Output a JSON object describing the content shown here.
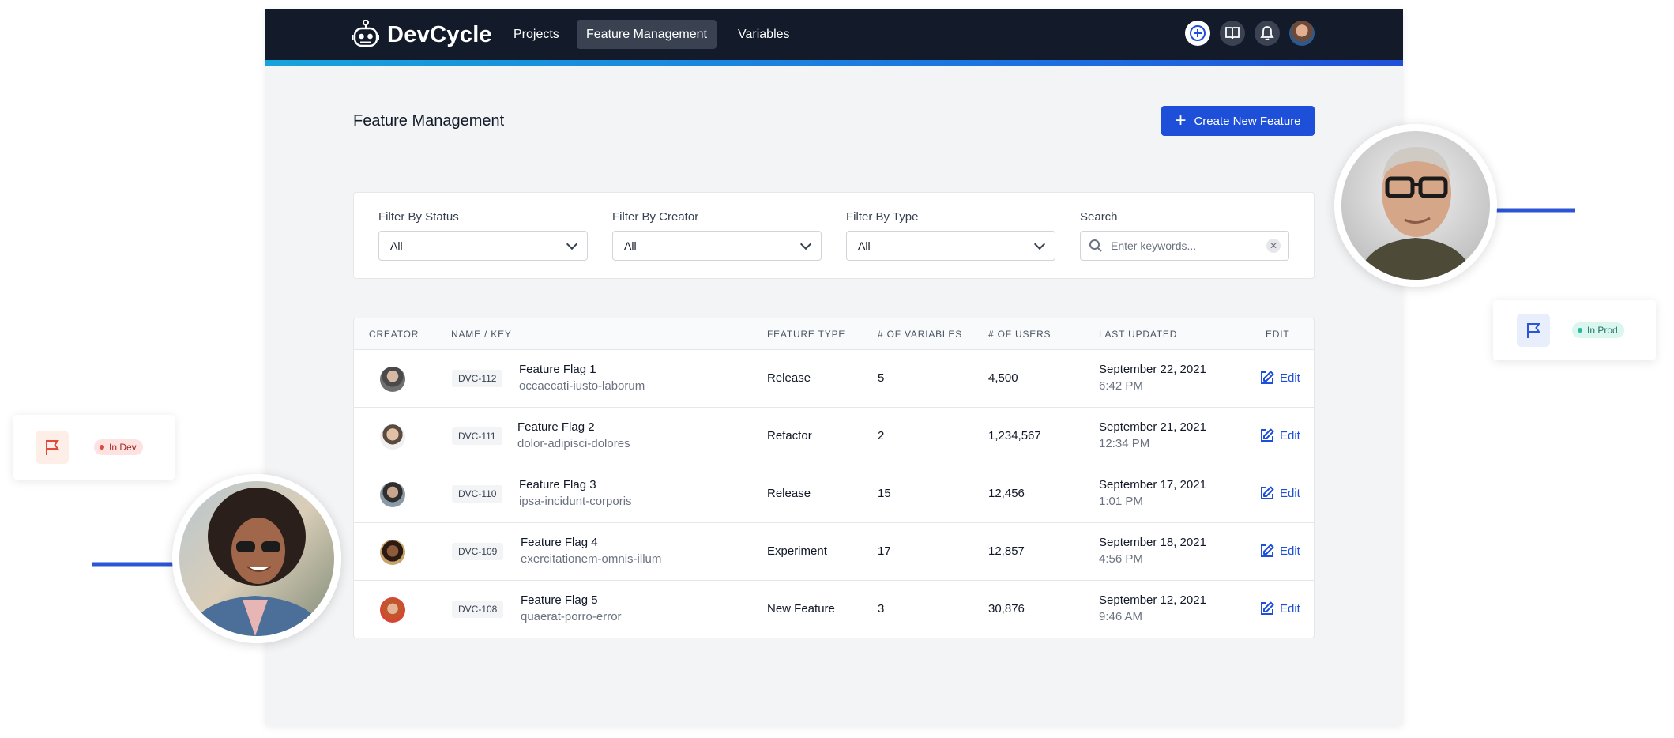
{
  "brand": {
    "name": "DevCycle"
  },
  "nav": {
    "items": [
      {
        "label": "Projects"
      },
      {
        "label": "Feature Management"
      },
      {
        "label": "Variables"
      }
    ]
  },
  "page": {
    "title": "Feature Management",
    "create_button": "Create New Feature"
  },
  "filters": {
    "status": {
      "label": "Filter By Status",
      "value": "All"
    },
    "creator": {
      "label": "Filter By Creator",
      "value": "All"
    },
    "type": {
      "label": "Filter By Type",
      "value": "All"
    },
    "search": {
      "label": "Search",
      "placeholder": "Enter keywords..."
    }
  },
  "table": {
    "headers": [
      "Creator",
      "Name / Key",
      "Feature Type",
      "# of Variables",
      "# of Users",
      "Last Updated",
      "Edit"
    ],
    "rows": [
      {
        "key": "DVC-112",
        "name": "Feature Flag 1",
        "slug": "occaecati-iusto-laborum",
        "type": "Release",
        "variables": "5",
        "users": "4,500",
        "date": "September 22, 2021",
        "time": "6:42 PM",
        "edit": "Edit"
      },
      {
        "key": "DVC-111",
        "name": "Feature Flag 2",
        "slug": "dolor-adipisci-dolores",
        "type": "Refactor",
        "variables": "2",
        "users": "1,234,567",
        "date": "September 21, 2021",
        "time": "12:34 PM",
        "edit": "Edit"
      },
      {
        "key": "DVC-110",
        "name": "Feature Flag 3",
        "slug": "ipsa-incidunt-corporis",
        "type": "Release",
        "variables": "15",
        "users": "12,456",
        "date": "September 17, 2021",
        "time": "1:01 PM",
        "edit": "Edit"
      },
      {
        "key": "DVC-109",
        "name": "Feature Flag 4",
        "slug": "exercitationem-omnis-illum",
        "type": "Experiment",
        "variables": "17",
        "users": "12,857",
        "date": "September 18, 2021",
        "time": "4:56 PM",
        "edit": "Edit"
      },
      {
        "key": "DVC-108",
        "name": "Feature Flag 5",
        "slug": "quaerat-porro-error",
        "type": "New Feature",
        "variables": "3",
        "users": "30,876",
        "date": "September 12, 2021",
        "time": "9:46 AM",
        "edit": "Edit"
      }
    ]
  },
  "decor": {
    "dev_badge": "In Dev",
    "prod_badge": "In Prod"
  },
  "colors": {
    "nav_bg": "#131a2a",
    "accent": "#1d4fd8",
    "dev_red": "#e1493b",
    "prod_green": "#2bb59b"
  }
}
